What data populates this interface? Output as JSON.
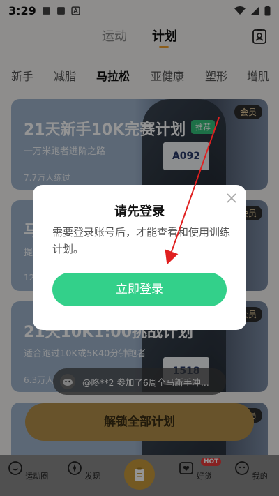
{
  "status_bar": {
    "time": "3:29"
  },
  "top_tabs": [
    {
      "label": "运动"
    },
    {
      "label": "计划"
    }
  ],
  "categories": [
    "新手",
    "减脂",
    "马拉松",
    "亚健康",
    "塑形",
    "增肌"
  ],
  "cards": [
    {
      "title": "21天新手10K完赛计划",
      "tag": "推荐",
      "subtitle": "一万米跑者进阶之路",
      "count": "7.7万人练过",
      "member": "会员",
      "bib": "A092"
    },
    {
      "title": "马",
      "subtitle": "提",
      "count": "12",
      "member": "会员"
    },
    {
      "title": "21天10K1:00挑战计划",
      "subtitle": "适合跑过10K或5K40分钟跑者",
      "count": "6.3万人",
      "member": "会员",
      "bib": "1518"
    },
    {
      "title": "",
      "member": "会员"
    }
  ],
  "ticker": {
    "text": "@咚**2 参加了6周全马新手冲..."
  },
  "unlock_button": {
    "label": "解锁全部计划"
  },
  "bottom_nav": [
    {
      "label": "运动圈",
      "icon": "chat-bubble-icon"
    },
    {
      "label": "发现",
      "icon": "compass-icon"
    },
    {
      "label": "",
      "icon": "plan-clipboard-icon"
    },
    {
      "label": "好货",
      "icon": "shop-heart-icon",
      "badge": "HOT"
    },
    {
      "label": "我的",
      "icon": "profile-face-icon"
    }
  ],
  "dialog": {
    "title": "请先登录",
    "message": "需要登录账号后，才能查看和使用训练计划。",
    "button_label": "立即登录"
  },
  "colors": {
    "accent_green": "#33d08a",
    "tab_underline": "#f0a030",
    "unlock_gold": "#b48f4a",
    "annotation_red": "#e02020"
  }
}
